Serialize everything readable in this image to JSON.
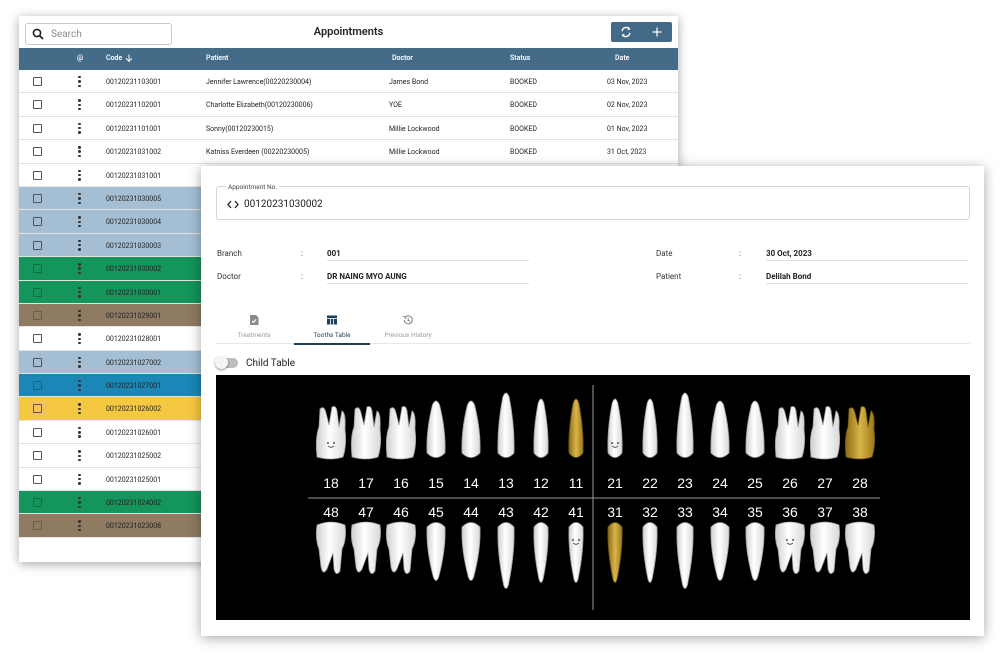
{
  "list": {
    "search_placeholder": "Search",
    "title": "Appointments",
    "refresh_icon": "refresh-icon",
    "add_icon": "plus-icon",
    "columns": {
      "menu": "@",
      "code": "Code",
      "patient": "Patient",
      "doctor": "Doctor",
      "status": "Status",
      "date": "Date"
    },
    "rows": [
      {
        "code": "00120231103001",
        "patient": "Jennifer Lawrence(00220230004)",
        "doctor": "James Bond",
        "status": "BOOKED",
        "date": "03 Nov, 2023",
        "color": "#ffffff"
      },
      {
        "code": "00120231102001",
        "patient": "Charlotte Elizabeth(00120230006)",
        "doctor": "YOE",
        "status": "BOOKED",
        "date": "02 Nov, 2023",
        "color": "#ffffff"
      },
      {
        "code": "00120231101001",
        "patient": "Sonny(00120230015)",
        "doctor": "Millie Lockwood",
        "status": "BOOKED",
        "date": "01 Nov, 2023",
        "color": "#ffffff"
      },
      {
        "code": "00120231031002",
        "patient": "Katniss Everdeen (00220230005)",
        "doctor": "Millie Lockwood",
        "status": "BOOKED",
        "date": "31 Oct, 2023",
        "color": "#ffffff"
      },
      {
        "code": "00120231031001",
        "patient": "",
        "doctor": "",
        "status": "",
        "date": "",
        "color": "#ffffff"
      },
      {
        "code": "00120231030005",
        "patient": "",
        "doctor": "",
        "status": "",
        "date": "",
        "color": "#a4bfd4"
      },
      {
        "code": "00120231030004",
        "patient": "",
        "doctor": "",
        "status": "",
        "date": "",
        "color": "#a4bfd4"
      },
      {
        "code": "00120231030003",
        "patient": "",
        "doctor": "",
        "status": "",
        "date": "",
        "color": "#a4bfd4"
      },
      {
        "code": "00120231030002",
        "patient": "",
        "doctor": "",
        "status": "",
        "date": "",
        "color": "#13955b"
      },
      {
        "code": "00120231030001",
        "patient": "",
        "doctor": "",
        "status": "",
        "date": "",
        "color": "#13955b"
      },
      {
        "code": "00120231029001",
        "patient": "",
        "doctor": "",
        "status": "",
        "date": "",
        "color": "#8f7a62"
      },
      {
        "code": "00120231028001",
        "patient": "",
        "doctor": "",
        "status": "",
        "date": "",
        "color": "#ffffff"
      },
      {
        "code": "00120231027002",
        "patient": "",
        "doctor": "",
        "status": "",
        "date": "",
        "color": "#a4bfd4"
      },
      {
        "code": "00120231027001",
        "patient": "",
        "doctor": "",
        "status": "",
        "date": "",
        "color": "#1a87b7"
      },
      {
        "code": "00120231026002",
        "patient": "",
        "doctor": "",
        "status": "",
        "date": "",
        "color": "#f5c842"
      },
      {
        "code": "00120231026001",
        "patient": "",
        "doctor": "",
        "status": "",
        "date": "",
        "color": "#ffffff"
      },
      {
        "code": "00120231025002",
        "patient": "",
        "doctor": "",
        "status": "",
        "date": "",
        "color": "#ffffff"
      },
      {
        "code": "00120231025001",
        "patient": "",
        "doctor": "",
        "status": "",
        "date": "",
        "color": "#ffffff"
      },
      {
        "code": "00120231024002",
        "patient": "",
        "doctor": "",
        "status": "",
        "date": "",
        "color": "#13955b"
      },
      {
        "code": "00120231023008",
        "patient": "",
        "doctor": "",
        "status": "",
        "date": "",
        "color": "#8f7a62"
      }
    ]
  },
  "detail": {
    "appointment_label": "Appointment No.",
    "appointment_no": "00120231030002",
    "code_icon": "code-brackets-icon",
    "branch_label": "Branch",
    "branch_value": "001",
    "doctor_label": "Doctor",
    "doctor_value": "DR NAING MYO AUNG",
    "date_label": "Date",
    "date_value": "30 Oct, 2023",
    "patient_label": "Patient",
    "patient_value": "Delilah Bond",
    "separator": ":",
    "tabs": [
      {
        "label": "Treatments",
        "icon": "document-icon",
        "active": false
      },
      {
        "label": "Tooths Table",
        "icon": "table-icon",
        "active": true
      },
      {
        "label": "Previous History",
        "icon": "history-icon",
        "active": false
      }
    ],
    "child_table_label": "Child Table",
    "child_table_on": false,
    "teeth": {
      "upper_numbers": [
        "18",
        "17",
        "16",
        "15",
        "14",
        "13",
        "12",
        "11",
        "21",
        "22",
        "23",
        "24",
        "25",
        "26",
        "27",
        "28"
      ],
      "lower_numbers": [
        "48",
        "47",
        "46",
        "45",
        "44",
        "43",
        "42",
        "41",
        "31",
        "32",
        "33",
        "34",
        "35",
        "36",
        "37",
        "38"
      ],
      "gold_teeth": [
        "11",
        "28",
        "31"
      ],
      "highlighted_teeth": [
        "18",
        "21",
        "41",
        "36"
      ]
    }
  }
}
